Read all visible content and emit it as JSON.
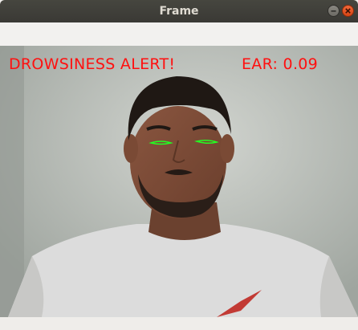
{
  "window": {
    "title": "Frame"
  },
  "overlay": {
    "alert_text": "DROWSINESS ALERT!",
    "ear_text": "EAR: 0.09",
    "text_color": "#ff1010",
    "eye_contour_color": "#22ff22"
  },
  "icons": {
    "minimize": "minimize-icon",
    "close": "close-icon"
  }
}
